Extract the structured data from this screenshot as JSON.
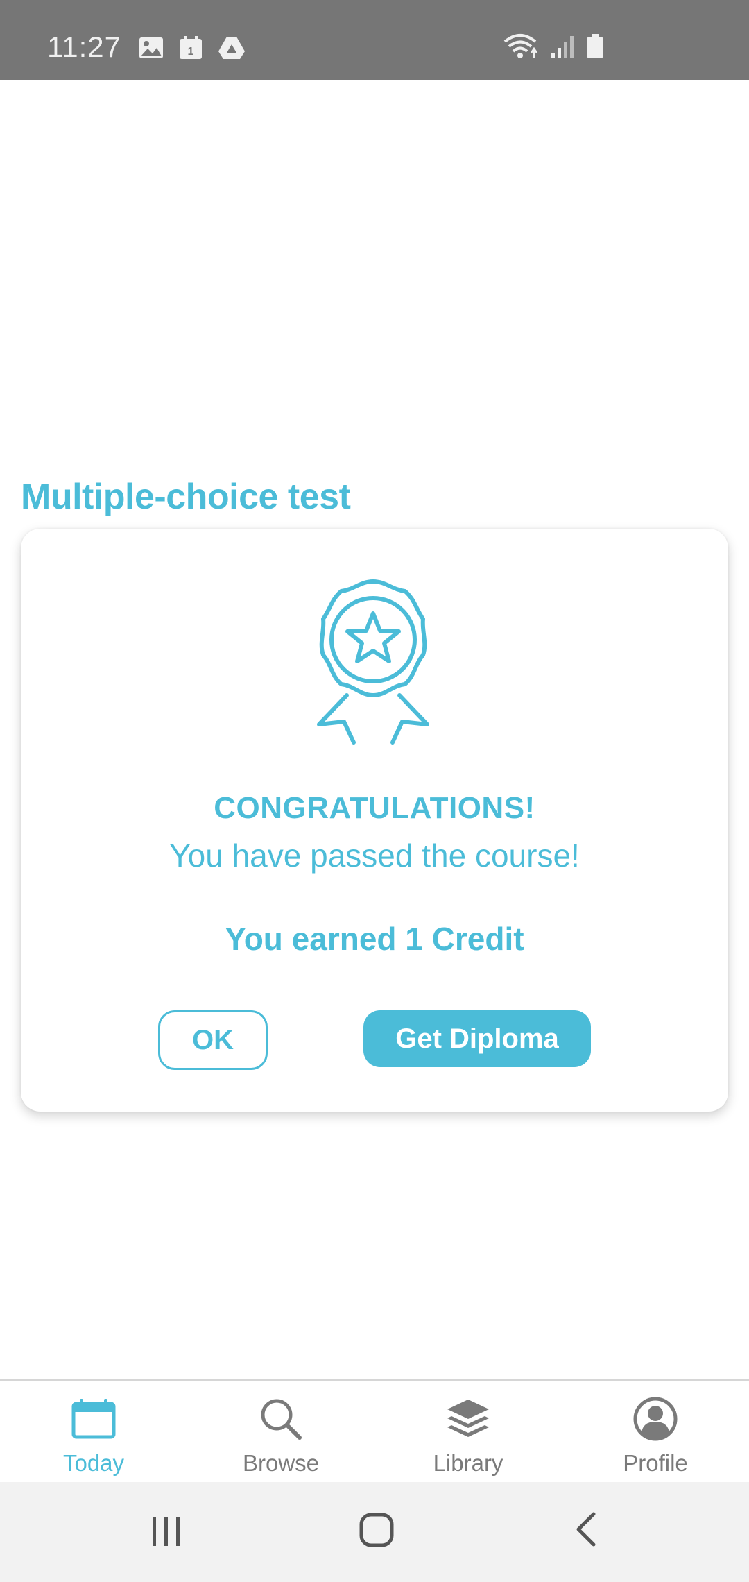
{
  "status_bar": {
    "time": "11:27",
    "notification_icons": [
      "image-icon",
      "calendar-icon",
      "drive-icon"
    ],
    "system_icons": [
      "wifi-icon",
      "signal-icon",
      "battery-icon"
    ],
    "background_color": "#767676"
  },
  "page": {
    "title": "Multiple-choice test"
  },
  "dialog": {
    "icon": "award-badge-icon",
    "heading": "CONGRATULATIONS!",
    "message": "You have passed the course!",
    "credit_text": "You earned 1 Credit",
    "ok_label": "OK",
    "diploma_label": "Get Diploma",
    "accent_color": "#4bbcd8"
  },
  "tab_bar": {
    "active_tab": "Today",
    "tabs": [
      {
        "label": "Today",
        "icon": "calendar-icon"
      },
      {
        "label": "Browse",
        "icon": "search-icon"
      },
      {
        "label": "Library",
        "icon": "layers-icon"
      },
      {
        "label": "Profile",
        "icon": "profile-icon"
      }
    ]
  },
  "nav_bar": {
    "buttons": [
      "recent-apps-icon",
      "home-icon",
      "back-icon"
    ]
  }
}
